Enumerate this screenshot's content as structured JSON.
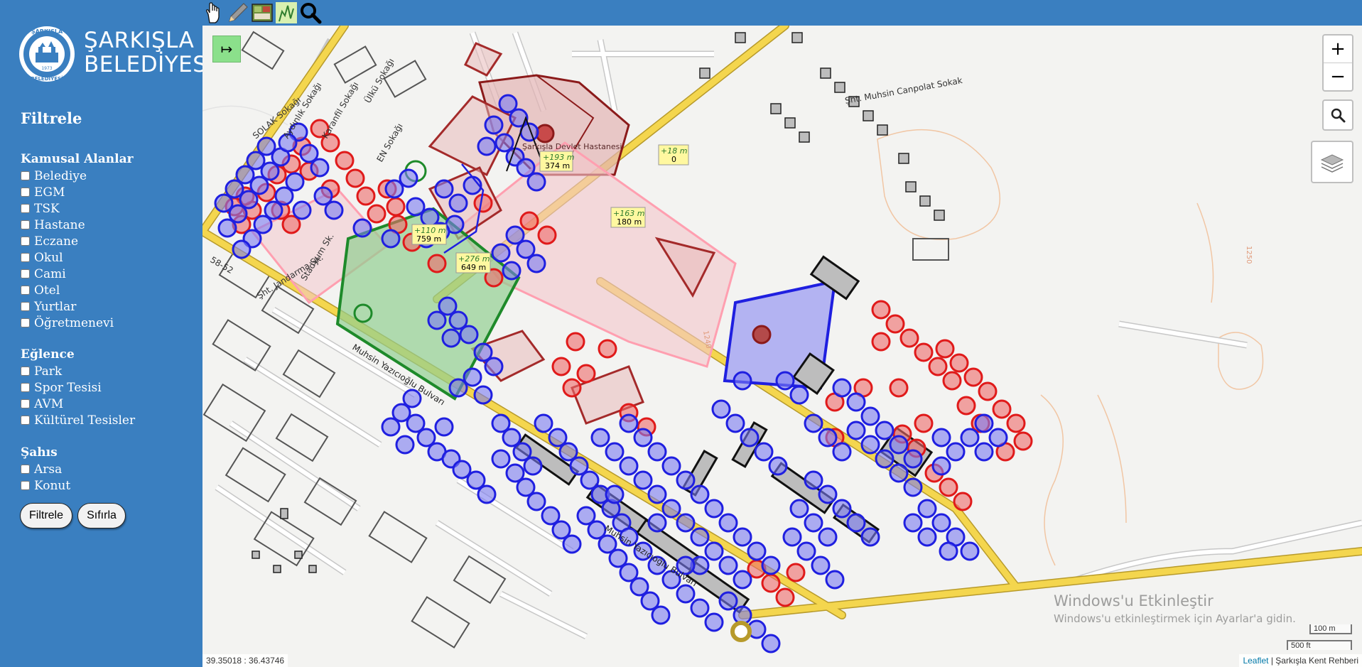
{
  "brand": {
    "seal_top": "ŞARKIŞLA",
    "seal_bottom": "BELEDİYESİ",
    "seal_year": "1973",
    "line1": "ŞARKIŞLA",
    "line2": "BELEDİYESİ"
  },
  "sidebar": {
    "title": "Filtrele",
    "groups": [
      {
        "title": "Kamusal Alanlar",
        "items": [
          "Belediye",
          "EGM",
          "TSK",
          "Hastane",
          "Eczane",
          "Okul",
          "Cami",
          "Otel",
          "Yurtlar",
          "Öğretmenevi"
        ]
      },
      {
        "title": "Eğlence",
        "items": [
          "Park",
          "Spor Tesisi",
          "AVM",
          "Kültürel Tesisler"
        ]
      },
      {
        "title": "Şahıs",
        "items": [
          "Arsa",
          "Konut"
        ]
      }
    ],
    "filter_button": "Filtrele",
    "reset_button": "Sıfırla"
  },
  "toolbar": {
    "tools": [
      "hand-icon",
      "pencil-icon",
      "map-layout-icon",
      "measure-icon",
      "search-icon"
    ]
  },
  "map": {
    "toggle_label": "↦",
    "zoom_in": "+",
    "zoom_out": "−",
    "coordinates": "39.35018 : 36.43746",
    "attribution_link": "Leaflet",
    "attribution_text": " | Şarkışla Kent Rehberi",
    "scale_metric": "100 m",
    "scale_imperial": "500 ft",
    "watermark_title": "Windows'u Etkinleştir",
    "watermark_sub": "Windows'u etkinleştirmek için Ayarlar'a gidin.",
    "street_labels": [
      "Şht. Muhsin Canpolat Sokak",
      "Muhsin Yazıcıoğlu Bulvarı",
      "Muhsin Yazıcıoğlu Bulvarı",
      "Aydınlık Sokağı",
      "Karanfil Sokağı",
      "Ülkü Sokağı",
      "SOLAK Sokağı",
      "EN Sokağı",
      "Stadyum Sk.",
      "Şht. Jandarma Sk.",
      "58-52",
      "Şarkışla Devlet Hastanesi",
      "1250",
      "1240"
    ],
    "measure_labels": [
      {
        "delta": "+193 m",
        "total": "374 m"
      },
      {
        "delta": "+18 m",
        "total": "0"
      },
      {
        "delta": "+163 m",
        "total": "180 m"
      },
      {
        "delta": "+110 m",
        "total": "759 m"
      },
      {
        "delta": "+276 m",
        "total": "649 m"
      }
    ],
    "colors": {
      "public": "#e02020",
      "residential": "#1f1fe0",
      "park": "#1e8a2a",
      "hospital": "#8b1a1a",
      "building": "#bdbdbd",
      "road": "#f4d64e"
    }
  }
}
